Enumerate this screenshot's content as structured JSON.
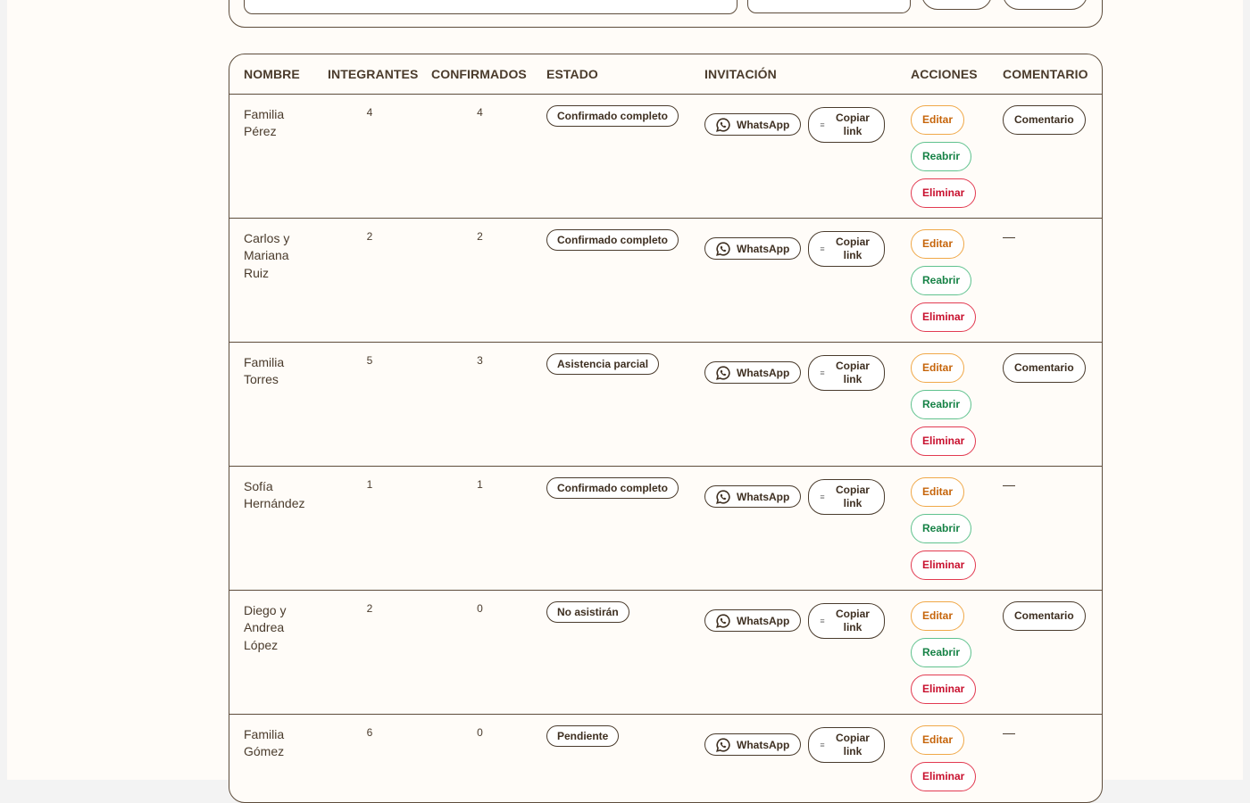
{
  "table": {
    "headers": {
      "name": "NOMBRE",
      "members": "INTEGRANTES",
      "confirmed": "CONFIRMADOS",
      "status": "ESTADO",
      "invitation": "INVITACIÓN",
      "actions": "ACCIONES",
      "comment": "COMENTARIO"
    },
    "labels": {
      "whatsapp": "WhatsApp",
      "copy_link": "Copiar link",
      "edit": "Editar",
      "reopen": "Reabrir",
      "delete": "Eliminar",
      "comment": "Comentario",
      "no_comment": "—"
    },
    "rows": [
      {
        "name": "Familia Pérez",
        "members": "4",
        "confirmed": "4",
        "status": "Confirmado completo",
        "has_comment": true,
        "show_reopen": true
      },
      {
        "name": "Carlos y Mariana Ruiz",
        "members": "2",
        "confirmed": "2",
        "status": "Confirmado completo",
        "has_comment": false,
        "show_reopen": true
      },
      {
        "name": "Familia Torres",
        "members": "5",
        "confirmed": "3",
        "status": "Asistencia parcial",
        "has_comment": true,
        "show_reopen": true
      },
      {
        "name": "Sofía Hernández",
        "members": "1",
        "confirmed": "1",
        "status": "Confirmado completo",
        "has_comment": false,
        "show_reopen": true
      },
      {
        "name": "Diego y Andrea López",
        "members": "2",
        "confirmed": "0",
        "status": "No asistirán",
        "has_comment": true,
        "show_reopen": true
      },
      {
        "name": "Familia Gómez",
        "members": "6",
        "confirmed": "0",
        "status": "Pendiente",
        "has_comment": false,
        "show_reopen": false
      }
    ]
  }
}
